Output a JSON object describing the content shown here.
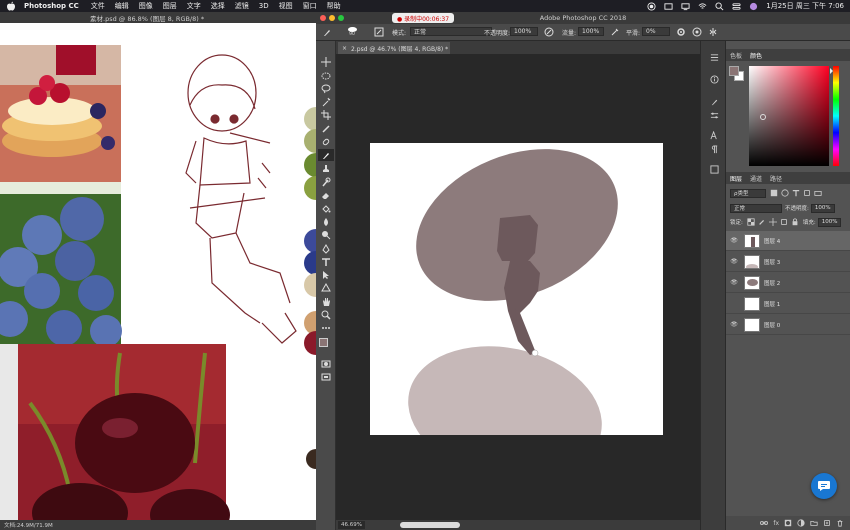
{
  "menubar": {
    "app_name": "Photoshop CC",
    "items": [
      "文件",
      "编辑",
      "图像",
      "图层",
      "文字",
      "选择",
      "滤镜",
      "3D",
      "视图",
      "窗口",
      "帮助"
    ],
    "datetime": "1月25日 周三 下午 7:06"
  },
  "left_doc": {
    "tab_title": "素材.psd @ 86.8% (图层 8, RGB/8) *",
    "status": "文档:24.9M/71.9M"
  },
  "ps_window": {
    "title": "Adobe Photoshop CC 2018",
    "recording": "● 录制中00:06:37"
  },
  "options_bar": {
    "brush_size": "90",
    "mode_label": "模式:",
    "mode_value": "正常",
    "opacity_label": "不透明度:",
    "opacity_value": "100%",
    "flow_label": "流量:",
    "flow_value": "100%",
    "smoothing_label": "平滑:",
    "smoothing_value": "0%"
  },
  "document": {
    "tab_title": "2.psd @ 46.7% (图层 4, RGB/8) *",
    "zoom": "46.69%"
  },
  "right_panels": {
    "top_tabs": [
      "色板",
      "颜色"
    ],
    "color": {
      "foreground": "#8a7474",
      "background": "#ffffff"
    },
    "layer_tabs": [
      "图层",
      "通道",
      "路径"
    ],
    "kind_filter": "ρ类型",
    "blend_mode": "正常",
    "opacity_label": "不透明度:",
    "opacity_value": "100%",
    "lock_label": "锁定:",
    "fill_label": "填充:",
    "fill_value": "100%",
    "layers": [
      {
        "name": "图层 4",
        "visible": true,
        "selected": true
      },
      {
        "name": "图层 3",
        "visible": true,
        "selected": false
      },
      {
        "name": "图层 2",
        "visible": true,
        "selected": false
      },
      {
        "name": "图层 1",
        "visible": false,
        "selected": false
      },
      {
        "name": "图层 0",
        "visible": true,
        "selected": false
      }
    ]
  }
}
